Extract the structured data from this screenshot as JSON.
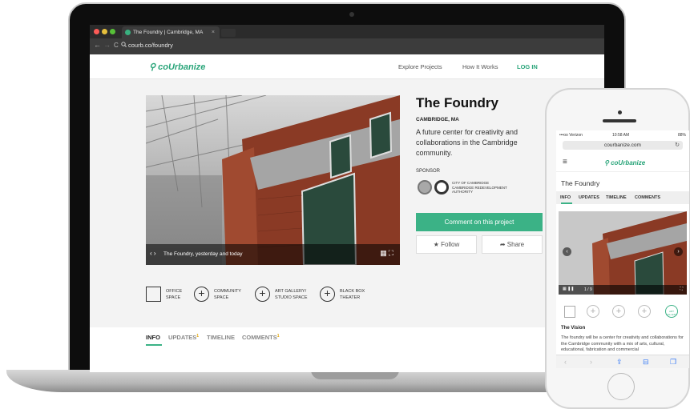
{
  "browser": {
    "tab_title": "The Foundry | Cambridge, MA",
    "tab_close": "×",
    "url": "courb.co/foundry",
    "back": "←",
    "forward": "→",
    "reload": "C"
  },
  "site": {
    "logo": "coUrbanize",
    "nav": [
      "Explore Projects",
      "How It Works",
      "LOG IN"
    ]
  },
  "project": {
    "title": "The Foundry",
    "location": "CAMBRIDGE, MA",
    "description": "A future center for creativity and collaborations in the Cambridge community.",
    "sponsor_label": "SPONSOR",
    "sponsor_name_1": "CITY OF CAMBRIDGE",
    "sponsor_name_2": "CAMBRIDGE REDEVELOPMENT AUTHORITY",
    "photo_caption": "The Foundry, yesterday and today",
    "photo_arrows": "‹ ›",
    "comment_button": "Comment on this project",
    "follow_button": "★ Follow",
    "share_button": "➦ Share"
  },
  "amenities": [
    {
      "line1": "OFFICE",
      "line2": "SPACE"
    },
    {
      "line1": "COMMUNITY",
      "line2": "SPACE"
    },
    {
      "line1": "ART GALLERY/",
      "line2": "STUDIO SPACE"
    },
    {
      "line1": "BLACK BOX",
      "line2": "THEATER"
    }
  ],
  "tabs": {
    "info": "INFO",
    "updates": "UPDATES",
    "updates_count": "1",
    "timeline": "TIMELINE",
    "comments": "COMMENTS",
    "comments_count": "1"
  },
  "phone": {
    "carrier": "•••oo Verizon",
    "time": "10:58 AM",
    "battery": "88%",
    "url": "courbanize.com",
    "logo": "coUrbanize",
    "menu": "≡",
    "project_title": "The Foundry",
    "tabs": [
      "INFO",
      "UPDATES",
      "TIMELINE",
      "COMMENTS"
    ],
    "photo_counter": "1 / 9",
    "amenity_highlight": "ART GALLERY",
    "vision_heading": "The Vision",
    "vision_text": "The foundry will be a center for creativity and collaborations for the Cambridge community with a mix of arts, cultural, educational, fabrication and commercial"
  },
  "colors": {
    "accent": "#3bb286",
    "brand_logo": "#2aa57a",
    "badge": "#e0a200"
  }
}
